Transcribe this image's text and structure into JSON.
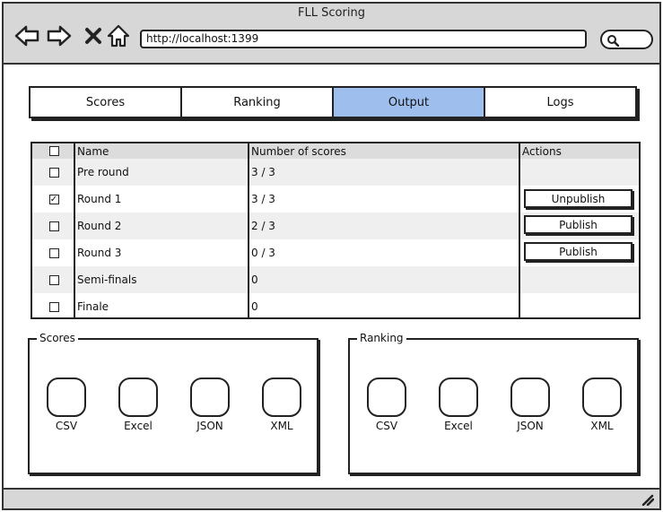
{
  "window": {
    "title": "FLL Scoring",
    "url": "http://localhost:1399"
  },
  "tabs": [
    {
      "label": "Scores",
      "active": false
    },
    {
      "label": "Ranking",
      "active": false
    },
    {
      "label": "Output",
      "active": true
    },
    {
      "label": "Logs",
      "active": false
    }
  ],
  "table": {
    "headers": {
      "name": "Name",
      "num": "Number of scores",
      "actions": "Actions"
    },
    "rows": [
      {
        "name": "Pre round",
        "num": "3 / 3",
        "checked": false,
        "action": ""
      },
      {
        "name": "Round 1",
        "num": "3 / 3",
        "checked": true,
        "action": "Unpublish"
      },
      {
        "name": "Round 2",
        "num": "2 / 3",
        "checked": false,
        "action": "Publish"
      },
      {
        "name": "Round 3",
        "num": "0 / 3",
        "checked": false,
        "action": "Publish"
      },
      {
        "name": "Semi-finals",
        "num": "0",
        "checked": false,
        "action": ""
      },
      {
        "name": "Finale",
        "num": "0",
        "checked": false,
        "action": ""
      }
    ]
  },
  "scores_group": {
    "label": "Scores",
    "items": [
      "CSV",
      "Excel",
      "JSON",
      "XML"
    ]
  },
  "ranking_group": {
    "label": "Ranking",
    "items": [
      "CSV",
      "Excel",
      "JSON",
      "XML"
    ]
  },
  "colors": {
    "active_tab": "#9ebfee",
    "chrome": "#d7d7d7"
  }
}
